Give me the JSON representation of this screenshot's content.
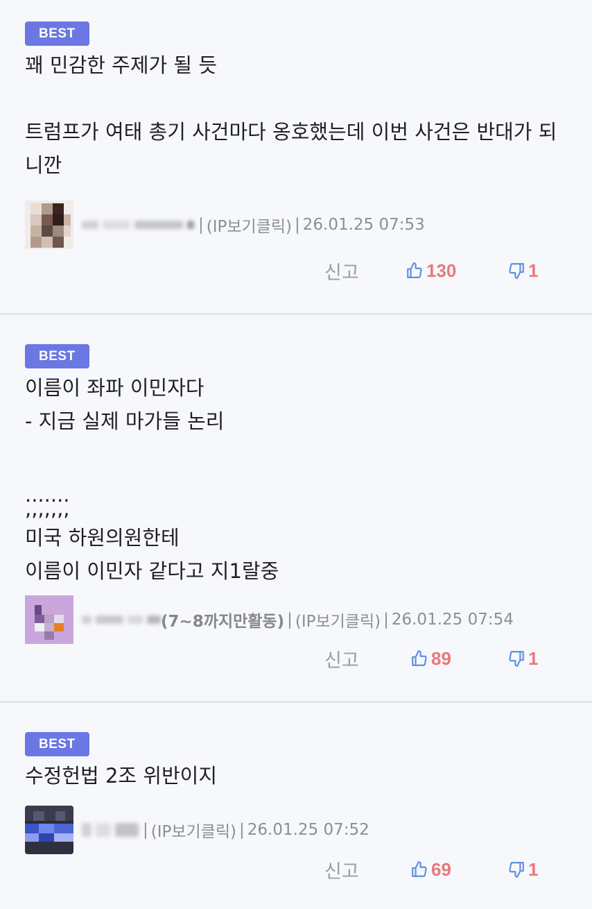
{
  "comments": [
    {
      "badge": "BEST",
      "lines": [
        "꽤 민감한 주제가 될 듯",
        "",
        "트럼프가 여태 총기 사건마다 옹호했는데 이번 사건은 반대가 되",
        "니깐"
      ],
      "nick_tail": "",
      "ip_label": "(IP보기클릭)",
      "timestamp": "26.01.25 07:53",
      "report_label": "신고",
      "likes": "130",
      "dislikes": "1"
    },
    {
      "badge": "BEST",
      "lines": [
        "이름이 좌파 이민자다",
        "- 지금 실제 마가들 논리",
        "",
        ".......",
        ",,,,,,,",
        "미국 하원의원한테",
        "이름이 이민자 같다고 지1랄중"
      ],
      "nick_tail": "(7~8까지만활동)",
      "ip_label": "(IP보기클릭)",
      "timestamp": "26.01.25 07:54",
      "report_label": "신고",
      "likes": "89",
      "dislikes": "1"
    },
    {
      "badge": "BEST",
      "lines": [
        "수정헌법 2조 위반이지"
      ],
      "nick_tail": "",
      "ip_label": "(IP보기클릭)",
      "timestamp": "26.01.25 07:52",
      "report_label": "신고",
      "likes": "69",
      "dislikes": "1"
    }
  ],
  "colors": {
    "badge": "#6b77e3",
    "vote_count": "#e8787b",
    "thumb_icon": "#5d8fe0"
  },
  "icons": {
    "like": "thumbs-up-icon",
    "dislike": "thumbs-down-icon"
  }
}
